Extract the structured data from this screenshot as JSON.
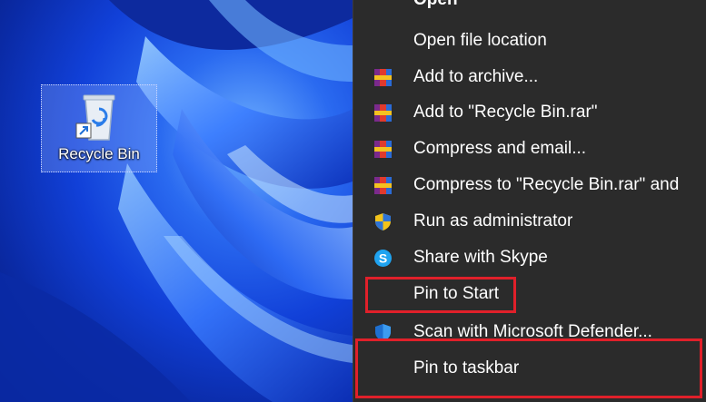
{
  "desktop": {
    "recycle_bin_label": "Recycle Bin"
  },
  "context_menu": {
    "items": [
      {
        "label": "Open",
        "icon": "none"
      },
      {
        "label": "Open file location",
        "icon": "none"
      },
      {
        "label": "Add to archive...",
        "icon": "winrar-icon"
      },
      {
        "label": "Add to \"Recycle Bin.rar\"",
        "icon": "winrar-icon"
      },
      {
        "label": "Compress and email...",
        "icon": "winrar-icon"
      },
      {
        "label": "Compress to \"Recycle Bin.rar\" and",
        "icon": "winrar-icon"
      },
      {
        "label": "Run as administrator",
        "icon": "uac-shield-icon"
      },
      {
        "label": "Share with Skype",
        "icon": "skype-icon"
      },
      {
        "label": "Pin to Start",
        "icon": "none"
      },
      {
        "label": "Scan with Microsoft Defender...",
        "icon": "defender-shield-icon"
      },
      {
        "label": "Pin to taskbar",
        "icon": "none"
      }
    ]
  },
  "colors": {
    "menu_background": "#2b2b2b",
    "highlight_border": "#e0202a",
    "wallpaper_blue": "#1140d8"
  }
}
